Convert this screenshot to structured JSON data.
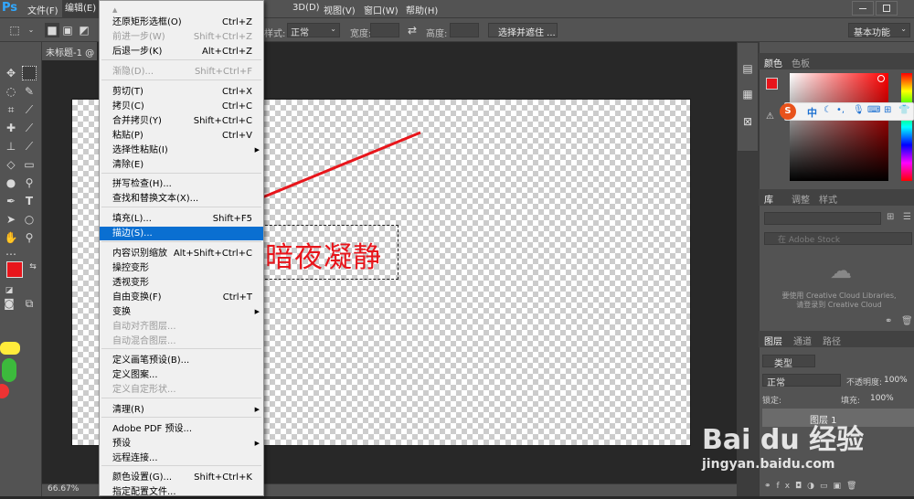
{
  "app": {
    "logo": "Ps"
  },
  "menubar": {
    "file": "文件(F)",
    "edit": "编辑(E)",
    "three_d": "3D(D)",
    "view": "视图(V)",
    "window": "窗口(W)",
    "help": "帮助(H)"
  },
  "options_bar": {
    "style_label": "样式:",
    "style_value": "正常",
    "width_label": "宽度:",
    "height_label": "高度:",
    "select_mask_button": "选择并遮住 ...",
    "workspace": "基本功能"
  },
  "document": {
    "tab_title": "未标题-1 @",
    "canvas_text": "暗夜凝静",
    "zoom": "66.67%"
  },
  "edit_menu": {
    "items": [
      {
        "label": "▲",
        "shortcut": "",
        "disabled": true
      },
      {
        "label": "还原矩形选框(O)",
        "shortcut": "Ctrl+Z"
      },
      {
        "label": "前进一步(W)",
        "shortcut": "Shift+Ctrl+Z",
        "disabled": true
      },
      {
        "label": "后退一步(K)",
        "shortcut": "Alt+Ctrl+Z"
      },
      {
        "label": "渐隐(D)...",
        "shortcut": "Shift+Ctrl+F",
        "disabled": true
      },
      {
        "label": "剪切(T)",
        "shortcut": "Ctrl+X"
      },
      {
        "label": "拷贝(C)",
        "shortcut": "Ctrl+C"
      },
      {
        "label": "合并拷贝(Y)",
        "shortcut": "Shift+Ctrl+C"
      },
      {
        "label": "粘贴(P)",
        "shortcut": "Ctrl+V"
      },
      {
        "label": "选择性粘贴(I)",
        "shortcut": "",
        "submenu": true
      },
      {
        "label": "清除(E)",
        "shortcut": ""
      },
      {
        "label": "拼写检查(H)...",
        "shortcut": ""
      },
      {
        "label": "查找和替换文本(X)...",
        "shortcut": ""
      },
      {
        "label": "填充(L)...",
        "shortcut": "Shift+F5"
      },
      {
        "label": "描边(S)...",
        "shortcut": "",
        "highlighted": true
      },
      {
        "label": "内容识别缩放",
        "shortcut": "Alt+Shift+Ctrl+C"
      },
      {
        "label": "操控变形",
        "shortcut": ""
      },
      {
        "label": "透视变形",
        "shortcut": ""
      },
      {
        "label": "自由变换(F)",
        "shortcut": "Ctrl+T"
      },
      {
        "label": "变换",
        "shortcut": "",
        "submenu": true
      },
      {
        "label": "自动对齐图层...",
        "shortcut": "",
        "disabled": true
      },
      {
        "label": "自动混合图层...",
        "shortcut": "",
        "disabled": true
      },
      {
        "label": "定义画笔预设(B)...",
        "shortcut": ""
      },
      {
        "label": "定义图案...",
        "shortcut": ""
      },
      {
        "label": "定义自定形状...",
        "shortcut": "",
        "disabled": true
      },
      {
        "label": "清理(R)",
        "shortcut": "",
        "submenu": true
      },
      {
        "label": "Adobe PDF 预设...",
        "shortcut": ""
      },
      {
        "label": "预设",
        "shortcut": "",
        "submenu": true
      },
      {
        "label": "远程连接...",
        "shortcut": ""
      },
      {
        "label": "颜色设置(G)...",
        "shortcut": "Shift+Ctrl+K"
      },
      {
        "label": "指定配置文件...",
        "shortcut": ""
      }
    ]
  },
  "panels": {
    "color_tabs": [
      "颜色",
      "色板"
    ],
    "lib_tabs": [
      "库",
      "调整",
      "样式"
    ],
    "lib_search_placeholder": "在 Adobe Stock",
    "cc_message_1": "要使用 Creative Cloud Libraries,",
    "cc_message_2": "请登录到 Creative Cloud",
    "layers_tabs": [
      "图层",
      "通道",
      "路径"
    ],
    "kind_label": "类型",
    "blend_mode": "正常",
    "opacity_label": "不透明度:",
    "opacity_value": "100%",
    "lock_label": "锁定:",
    "fill_label": "填充:",
    "fill_value": "100%",
    "layer_name": "图层 1"
  },
  "ime": {
    "chinese": "中"
  },
  "watermark": {
    "brand": "Bai du 经验",
    "url": "jingyan.baidu.com"
  },
  "colors": {
    "accent": "#0a6fd1",
    "foreground": "#e8151b",
    "arrow": "#e8151b"
  }
}
